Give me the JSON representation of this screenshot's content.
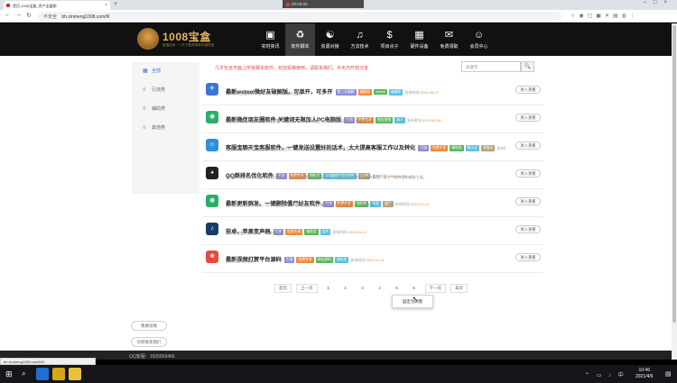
{
  "browser": {
    "tab_title": "首页-1008宝盒_资产宝盒聊",
    "new_tab": "+",
    "recording_label": "00:00:00",
    "url_security": "不安全",
    "url": "bh.xinmeng1008.com/ll/",
    "status_url": "bh.xinmeng1008.com/ll/4/"
  },
  "site": {
    "logo_text": "1008宝盒",
    "logo_sub": "宝盒技术 · 一天下载资源软件通货宝"
  },
  "nav": [
    {
      "label": "实时资讯",
      "icon": "news-icon",
      "glyph": "▣"
    },
    {
      "label": "软件脚本",
      "icon": "recycle-icon",
      "glyph": "♻"
    },
    {
      "label": "资源对接",
      "icon": "handshake-icon",
      "glyph": "☯"
    },
    {
      "label": "方法技术",
      "icon": "guitar-icon",
      "glyph": "♫"
    },
    {
      "label": "项目点子",
      "icon": "dollar-icon",
      "glyph": "$"
    },
    {
      "label": "硬件设备",
      "icon": "device-icon",
      "glyph": "▦"
    },
    {
      "label": "免费领取",
      "icon": "gift-icon",
      "glyph": "✉"
    },
    {
      "label": "会员中心",
      "icon": "user-icon",
      "glyph": "☺"
    }
  ],
  "sidebar": [
    {
      "label": "全部",
      "icon": "grid-icon",
      "glyph": "▦",
      "active": true
    },
    {
      "label": "引流类",
      "icon": "list-icon",
      "glyph": "≡",
      "active": false
    },
    {
      "label": "辅助类",
      "icon": "list-icon",
      "glyph": "≡",
      "active": false
    },
    {
      "label": "其他类",
      "icon": "list-icon",
      "glyph": "≡",
      "active": false
    }
  ],
  "notice": "几乎包含市面上所有脚本软件，欢迎投稿使用，请联系我们，半天内开放分享",
  "search": {
    "placeholder": "关键字",
    "button": "🔍"
  },
  "enter_label": "进入查看",
  "date_prefix": "发布时间:",
  "rows": [
    {
      "title": "最新wetool微好友破解版，可单开，可多开",
      "desc": "wetool微信破解版，可单开，可多开，永久使用。",
      "date": "2020-06-27",
      "icon": "rocket-icon",
      "glyph": "✈",
      "color": "#3a77d0",
      "tags": [
        {
          "t": "第三方破解",
          "c": "#8e8ed8"
        },
        {
          "t": "破解版",
          "c": "#f08a3c"
        },
        {
          "t": "wetool",
          "c": "#5cb85c"
        },
        {
          "t": "破解版",
          "c": "#5bc0de"
        }
      ]
    },
    {
      "title": "最新微信朋友圈软件-关键词无限加人PC电脑版",
      "desc": "微信营销软件，全自动加微信好友，无限制一天可以一直加，到时满有时间过段，电脑版下载。",
      "date": "2019-09-18",
      "icon": "wechat-icon",
      "glyph": "◉",
      "color": "#2aae67",
      "tags": [
        {
          "t": "引流",
          "c": "#8e8ed8"
        },
        {
          "t": "免费专享",
          "c": "#f08a3c"
        },
        {
          "t": "微信营销",
          "c": "#5cb85c"
        },
        {
          "t": "加人",
          "c": "#5bc0de"
        }
      ]
    },
    {
      "title": "客服宝聊天宝客服软件，一键发送设置好的话术，大大提高客服工作以及转化",
      "desc": "客服宝聊天软件，一键发送设置好的话术，大大提高客服工作以及转化 十几万多！！！！",
      "date": "2019-09-12",
      "icon": "chat-icon",
      "glyph": "☺",
      "color": "#2f8fd8",
      "tags": [
        {
          "t": "引流",
          "c": "#8e8ed8"
        },
        {
          "t": "免费专享",
          "c": "#f08a3c"
        },
        {
          "t": "辅助类",
          "c": "#5cb85c"
        },
        {
          "t": "聊天宝",
          "c": "#5bc0de"
        },
        {
          "t": "客服宝",
          "c": "#b8a07a"
        }
      ]
    },
    {
      "title": "QQ群排名优化软件",
      "desc": "很多营销的QQ群排名工具都是指卖家，QQ群排名优化效果多不好，一款好的QQ群优化软件真是，无十个软件用的辅助工具。",
      "date": "2019-08-10",
      "icon": "qq-icon",
      "glyph": "◕",
      "color": "#222",
      "tags": [
        {
          "t": "引流",
          "c": "#8e8ed8"
        },
        {
          "t": "免费专享",
          "c": "#f08a3c"
        },
        {
          "t": "辅助类",
          "c": "#5cb85c"
        },
        {
          "t": "QQ群排名优化软件",
          "c": "#5bc0de"
        },
        {
          "t": "QQ群",
          "c": "#b8a07a"
        }
      ]
    },
    {
      "title": "最新更新群发、一键删除僵尸好友软件",
      "desc": "支持群发，自定义群发，24小时全程群发一键清理僵尸粉，操作简单，能实现多一个清理工具。",
      "date": "2019-07-12",
      "icon": "wechat-icon",
      "glyph": "◉",
      "color": "#2aae67",
      "tags": [
        {
          "t": "引流",
          "c": "#8e8ed8"
        },
        {
          "t": "免费专享",
          "c": "#f08a3c"
        },
        {
          "t": "辅助类",
          "c": "#5cb85c"
        },
        {
          "t": "群发",
          "c": "#5bc0de"
        },
        {
          "t": "僵尸",
          "c": "#b8a07a"
        }
      ]
    },
    {
      "title": "安卓、苹果变声器",
      "desc": "通大家说变声器，安卓、苹果变声器",
      "date": "2019-06-14",
      "icon": "voice-icon",
      "glyph": "♪",
      "color": "#163d6b",
      "tags": [
        {
          "t": "引流",
          "c": "#8e8ed8"
        },
        {
          "t": "免费专享",
          "c": "#f08a3c"
        },
        {
          "t": "辅助类",
          "c": "#5cb85c"
        },
        {
          "t": "变声",
          "c": "#5bc0de"
        }
      ]
    },
    {
      "title": "最新视频打赏平台源码",
      "desc": "视频打赏平台源码",
      "date": "2019-10-31",
      "icon": "gift-icon",
      "glyph": "❀",
      "color": "#e8493e",
      "tags": [
        {
          "t": "引流",
          "c": "#8e8ed8"
        },
        {
          "t": "免费专享",
          "c": "#f08a3c"
        },
        {
          "t": "网站源码",
          "c": "#5cb85c"
        },
        {
          "t": "源码类",
          "c": "#5bc0de"
        }
      ]
    }
  ],
  "pager": {
    "first": "首页",
    "prev": "上一页",
    "pages": [
      "1",
      "2",
      "3",
      "4",
      "5",
      "6"
    ],
    "current": "1",
    "next": "下一页",
    "last": "末页"
  },
  "tooltip": "固定为顾客",
  "float_buttons": [
    "我要投稿",
    "问卷联系我们"
  ],
  "footer_text": "QQ客服：1505569466",
  "taskbar": {
    "time": "10:46",
    "date": "2021/4/9"
  }
}
